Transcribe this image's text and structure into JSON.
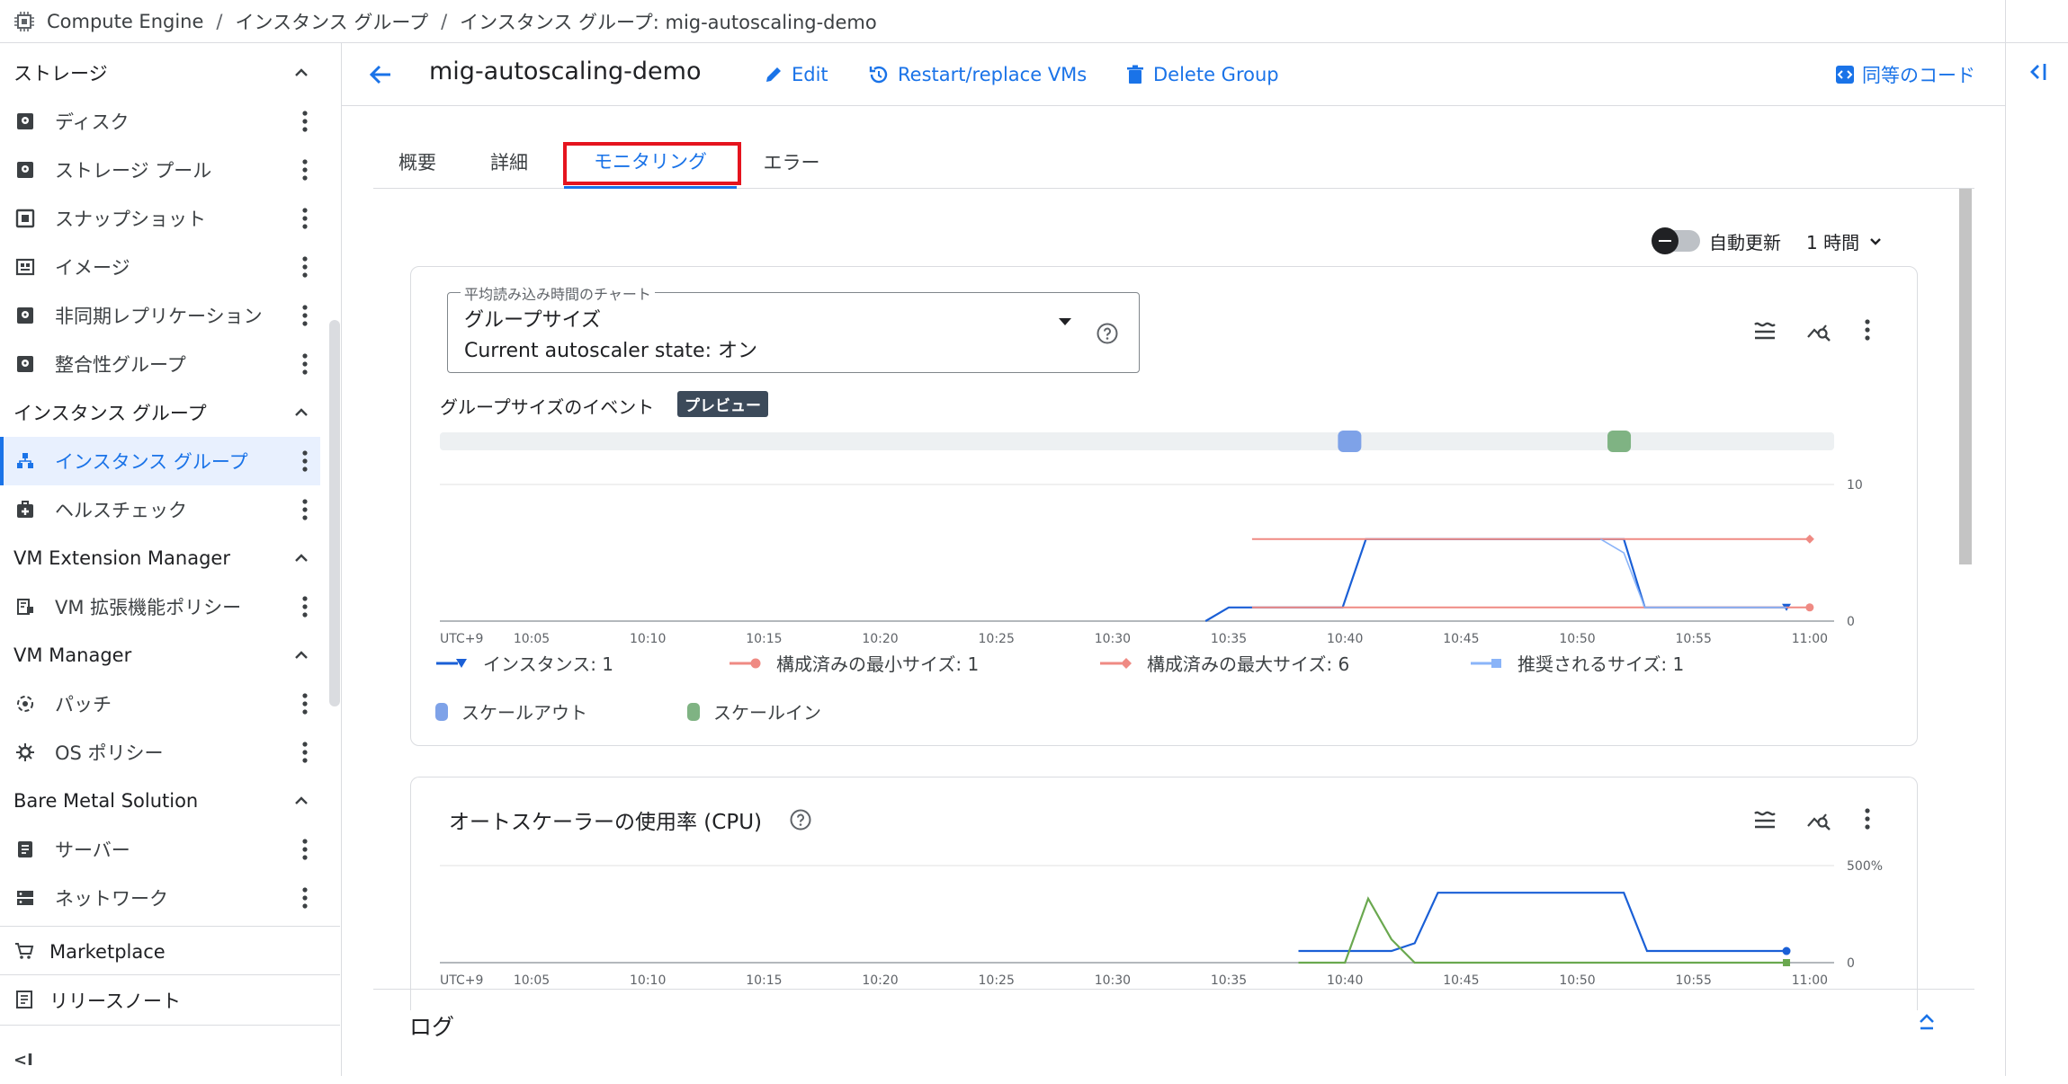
{
  "breadcrumb": {
    "product": "Compute Engine",
    "sep1": "/",
    "parent": "インスタンス グループ",
    "sep2": "/",
    "current": "インスタンス グループ: mig-autoscaling-demo"
  },
  "sidebar": {
    "storage_section": "ストレージ",
    "storage_items": [
      "ディスク",
      "ストレージ プール",
      "スナップショット",
      "イメージ",
      "非同期レプリケーション",
      "整合性グループ"
    ],
    "ig_section": "インスタンス グループ",
    "ig_items": [
      "インスタンス グループ",
      "ヘルスチェック"
    ],
    "vmext_section": "VM Extension Manager",
    "vmext_items": [
      "VM 拡張機能ポリシー"
    ],
    "vmmgr_section": "VM Manager",
    "vmmgr_items": [
      "パッチ",
      "OS ポリシー"
    ],
    "bms_section": "Bare Metal Solution",
    "bms_items": [
      "サーバー",
      "ネットワーク"
    ],
    "marketplace": "Marketplace",
    "release_notes": "リリースノート",
    "collapse_label": "<I"
  },
  "header": {
    "title": "mig-autoscaling-demo",
    "edit": "Edit",
    "restart": "Restart/replace VMs",
    "delete": "Delete Group",
    "equivalent_code": "同等のコード"
  },
  "tabs": [
    "概要",
    "詳細",
    "モニタリング",
    "エラー"
  ],
  "active_tab": "モニタリング",
  "toolbar": {
    "auto_refresh": "自動更新",
    "auto_refresh_on": false,
    "period": "1 時間"
  },
  "card1": {
    "select_legend": "平均読み込み時間のチャート",
    "select_value": "グループサイズ",
    "autoscaler_state": "Current autoscaler state: オン",
    "events_label": "グループサイズのイベント",
    "preview_badge": "プレビュー",
    "legend": [
      "インスタンス: 1",
      "構成済みの最小サイズ: 1",
      "構成済みの最大サイズ: 6",
      "推奨されるサイズ: 1"
    ],
    "event_legend": [
      "スケールアウト",
      "スケールイン"
    ]
  },
  "card2": {
    "title": "オートスケーラーの使用率 (CPU)"
  },
  "logs": {
    "title": "ログ"
  },
  "colors": {
    "accent": "#1a73e8",
    "instances": "#1a5fd6",
    "min": "#ef8a83",
    "max": "#ef8a83",
    "recommended": "#8ab4f8",
    "scale_out": "#7ea2e8",
    "scale_in": "#7fb383",
    "cpu_green": "#6aa84f",
    "tab_highlight": "#e5141e"
  },
  "chart_data": [
    {
      "type": "line",
      "title": "グループサイズ",
      "x": [
        "10:05",
        "10:10",
        "10:15",
        "10:20",
        "10:25",
        "10:30",
        "10:35",
        "10:40",
        "10:45",
        "10:50",
        "10:55",
        "11:00"
      ],
      "x_prefix": "UTC+9",
      "ylim": [
        0,
        10
      ],
      "yticks": [
        "10",
        "0"
      ],
      "series": [
        {
          "name": "インスタンス: 1",
          "points": [
            [
              34.0,
              0
            ],
            [
              35.0,
              1
            ],
            [
              39.9,
              1
            ],
            [
              40.9,
              6
            ],
            [
              52.0,
              6
            ],
            [
              52.9,
              1
            ],
            [
              59.0,
              1
            ]
          ]
        },
        {
          "name": "構成済みの最小サイズ: 1",
          "points": [
            [
              36.0,
              1
            ],
            [
              60.0,
              1
            ]
          ]
        },
        {
          "name": "構成済みの最大サイズ: 6",
          "points": [
            [
              36.0,
              6
            ],
            [
              60.0,
              6
            ]
          ]
        },
        {
          "name": "推奨されるサイズ: 1",
          "points": [
            [
              51.0,
              6
            ],
            [
              52.0,
              5
            ],
            [
              52.9,
              1
            ],
            [
              59.0,
              1
            ]
          ]
        }
      ],
      "events": [
        {
          "name": "スケールアウト",
          "x": 40.2
        },
        {
          "name": "スケールイン",
          "x": 51.8
        }
      ]
    },
    {
      "type": "line",
      "title": "オートスケーラーの使用率 (CPU)",
      "x": [
        "10:05",
        "10:10",
        "10:15",
        "10:20",
        "10:25",
        "10:30",
        "10:35",
        "10:40",
        "10:45",
        "10:50",
        "10:55",
        "11:00"
      ],
      "x_prefix": "UTC+9",
      "ylim": [
        0,
        500
      ],
      "yticks": [
        "500%",
        "0"
      ],
      "series": [
        {
          "name": "blue",
          "points": [
            [
              38.0,
              60
            ],
            [
              42.0,
              60
            ],
            [
              43.0,
              100
            ],
            [
              44.0,
              360
            ],
            [
              52.0,
              360
            ],
            [
              53.0,
              60
            ],
            [
              59.0,
              60
            ]
          ]
        },
        {
          "name": "green",
          "points": [
            [
              38.0,
              0
            ],
            [
              40.0,
              0
            ],
            [
              41.0,
              330
            ],
            [
              42.0,
              120
            ],
            [
              43.0,
              0
            ],
            [
              59.0,
              0
            ]
          ]
        }
      ]
    }
  ]
}
